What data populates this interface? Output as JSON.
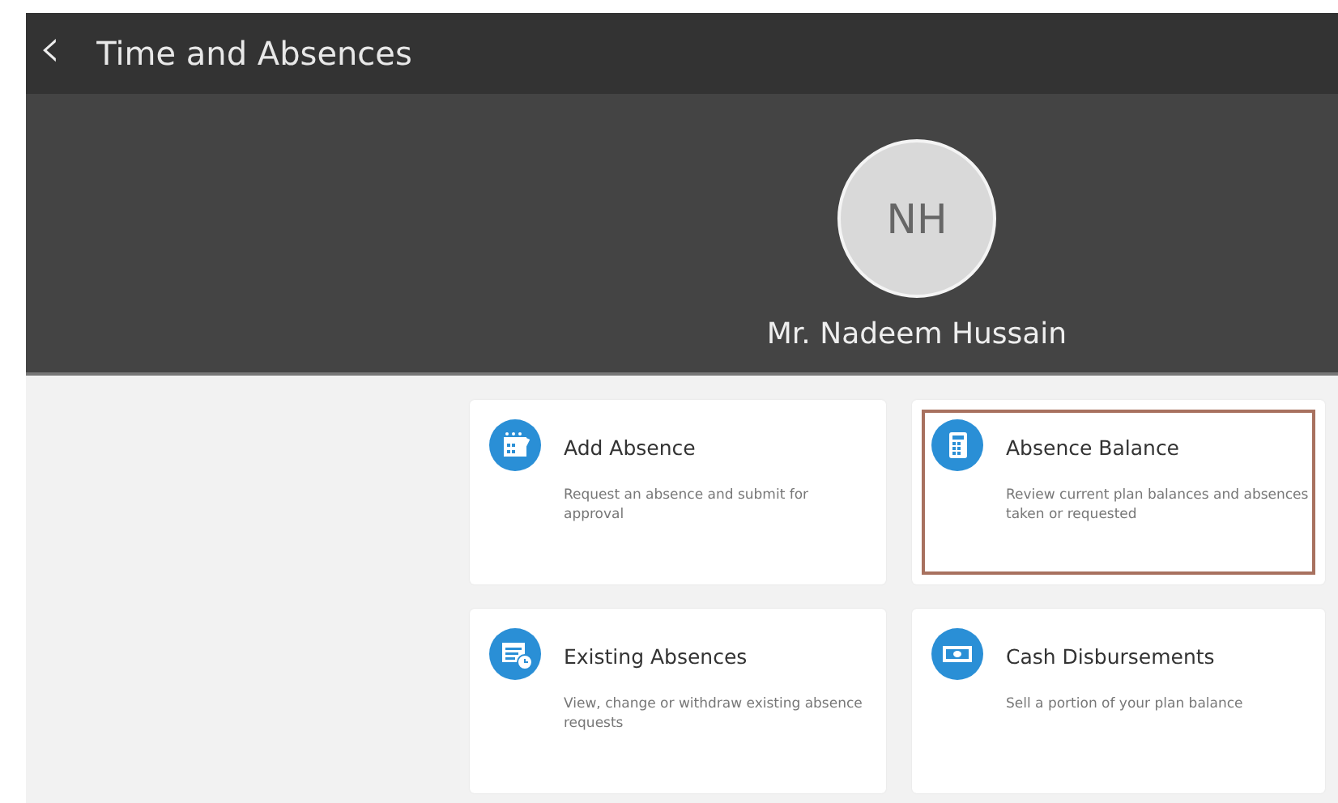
{
  "header": {
    "back_icon": "‹",
    "title": "Time and Absences"
  },
  "profile": {
    "initials": "NH",
    "name": "Mr. Nadeem Hussain"
  },
  "tiles": [
    {
      "kind": "calendar",
      "title": "Add Absence",
      "description": "Request an absence and submit for approval",
      "selected": false
    },
    {
      "kind": "calculator",
      "title": "Absence Balance",
      "description": "Review current plan balances and absences taken or requested",
      "selected": true
    },
    {
      "kind": "list",
      "title": "Existing Absences",
      "description": "View, change or withdraw existing absence requests",
      "selected": false
    },
    {
      "kind": "cash",
      "title": "Cash Disbursements",
      "description": "Sell a portion of your plan balance",
      "selected": false
    }
  ]
}
